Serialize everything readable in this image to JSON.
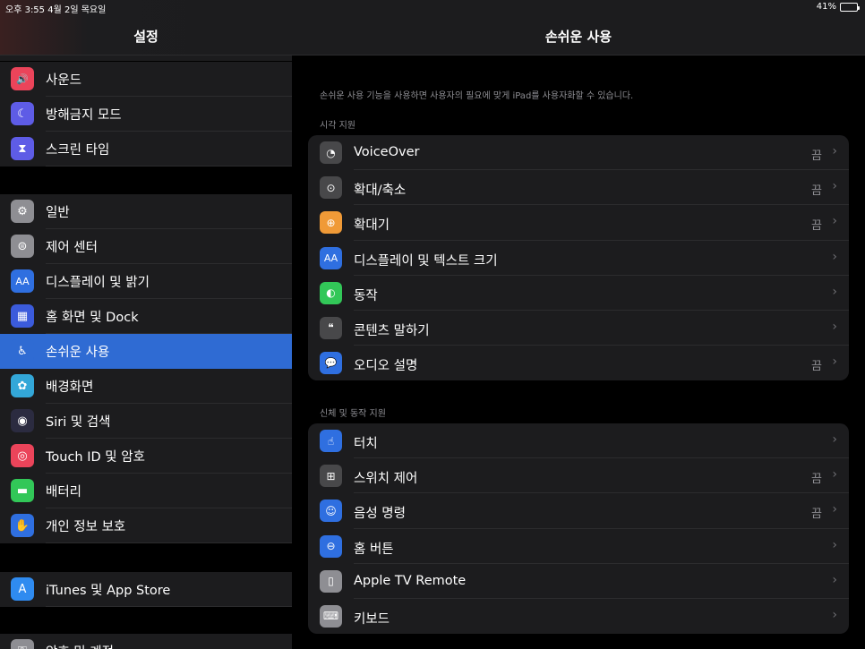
{
  "status": {
    "time": "오후 3:55   4월 2일 목요일",
    "battery_text": "41%",
    "battery_level": 0.41
  },
  "sidebar": {
    "title": "설정",
    "group1": [
      {
        "label": "사운드",
        "icon": "speaker-icon",
        "color": "#eb445a",
        "glyph": "🔊"
      },
      {
        "label": "방해금지 모드",
        "icon": "moon-icon",
        "color": "#5e5ce6",
        "glyph": "☾"
      },
      {
        "label": "스크린 타임",
        "icon": "hourglass-icon",
        "color": "#5e5ce6",
        "glyph": "⧗"
      }
    ],
    "group2": [
      {
        "label": "일반",
        "icon": "gear-icon",
        "color": "#8e8e93",
        "glyph": "⚙"
      },
      {
        "label": "제어 센터",
        "icon": "toggles-icon",
        "color": "#8e8e93",
        "glyph": "⊜"
      },
      {
        "label": "디스플레이 및 밝기",
        "icon": "text-size-icon",
        "color": "#2f6fe0",
        "glyph": "AA"
      },
      {
        "label": "홈 화면 및 Dock",
        "icon": "grid-icon",
        "color": "#3b5bdb",
        "glyph": "▦"
      },
      {
        "label": "손쉬운 사용",
        "icon": "accessibility-icon",
        "color": "#2f6bd3",
        "glyph": "♿"
      },
      {
        "label": "배경화면",
        "icon": "flower-icon",
        "color": "#33a7d8",
        "glyph": "✿"
      },
      {
        "label": "Siri 및 검색",
        "icon": "siri-icon",
        "color": "#2b2b40",
        "glyph": "◉"
      },
      {
        "label": "Touch ID 및 암호",
        "icon": "fingerprint-icon",
        "color": "#eb445a",
        "glyph": "◎"
      },
      {
        "label": "배터리",
        "icon": "battery-icon",
        "color": "#32c758",
        "glyph": "▬"
      },
      {
        "label": "개인 정보 보호",
        "icon": "hand-icon",
        "color": "#2f6fe0",
        "glyph": "✋"
      }
    ],
    "group3": [
      {
        "label": "iTunes 및 App Store",
        "icon": "app-store-icon",
        "color": "#2f8bf0",
        "glyph": "A"
      }
    ],
    "group4": [
      {
        "label": "암호 및 계정",
        "icon": "key-icon",
        "color": "#8e8e93",
        "glyph": "⚿"
      }
    ]
  },
  "main": {
    "title": "손쉬운 사용",
    "description": "손쉬운 사용 기능을 사용하면 사용자의 필요에 맞게 iPad를 사용자화할 수 있습니다.",
    "section1_label": "시각 지원",
    "section1": [
      {
        "label": "VoiceOver",
        "value": "끔",
        "icon": "voiceover-icon",
        "color": "#48484a",
        "glyph": "◔"
      },
      {
        "label": "확대/축소",
        "value": "끔",
        "icon": "zoom-icon",
        "color": "#48484a",
        "glyph": "⊙"
      },
      {
        "label": "확대기",
        "value": "끔",
        "icon": "magnifier-icon",
        "color": "#f09a37",
        "glyph": "⊕"
      },
      {
        "label": "디스플레이 및 텍스트 크기",
        "value": "",
        "icon": "text-size-icon",
        "color": "#2f6fe0",
        "glyph": "AA"
      },
      {
        "label": "동작",
        "value": "",
        "icon": "motion-icon",
        "color": "#32c758",
        "glyph": "◐"
      },
      {
        "label": "콘텐츠 말하기",
        "value": "",
        "icon": "speech-bubble-icon",
        "color": "#48484a",
        "glyph": "❝"
      },
      {
        "label": "오디오 설명",
        "value": "끔",
        "icon": "audio-description-icon",
        "color": "#2f6fe0",
        "glyph": "💬"
      }
    ],
    "section2_label": "신체 및 동작 지원",
    "section2": [
      {
        "label": "터치",
        "value": "",
        "icon": "hand-point-icon",
        "color": "#2f6fe0",
        "glyph": "☝"
      },
      {
        "label": "스위치 제어",
        "value": "끔",
        "icon": "switch-grid-icon",
        "color": "#48484a",
        "glyph": "⊞"
      },
      {
        "label": "음성 명령",
        "value": "끔",
        "icon": "voice-control-icon",
        "color": "#2f6fe0",
        "glyph": "☺"
      },
      {
        "label": "홈 버튼",
        "value": "",
        "icon": "home-button-icon",
        "color": "#2f6fe0",
        "glyph": "⊖"
      },
      {
        "label": "Apple TV Remote",
        "value": "",
        "icon": "remote-icon",
        "color": "#8e8e93",
        "glyph": "▯"
      },
      {
        "label": "키보드",
        "value": "",
        "icon": "keyboard-icon",
        "color": "#8e8e93",
        "glyph": "⌨"
      }
    ]
  }
}
